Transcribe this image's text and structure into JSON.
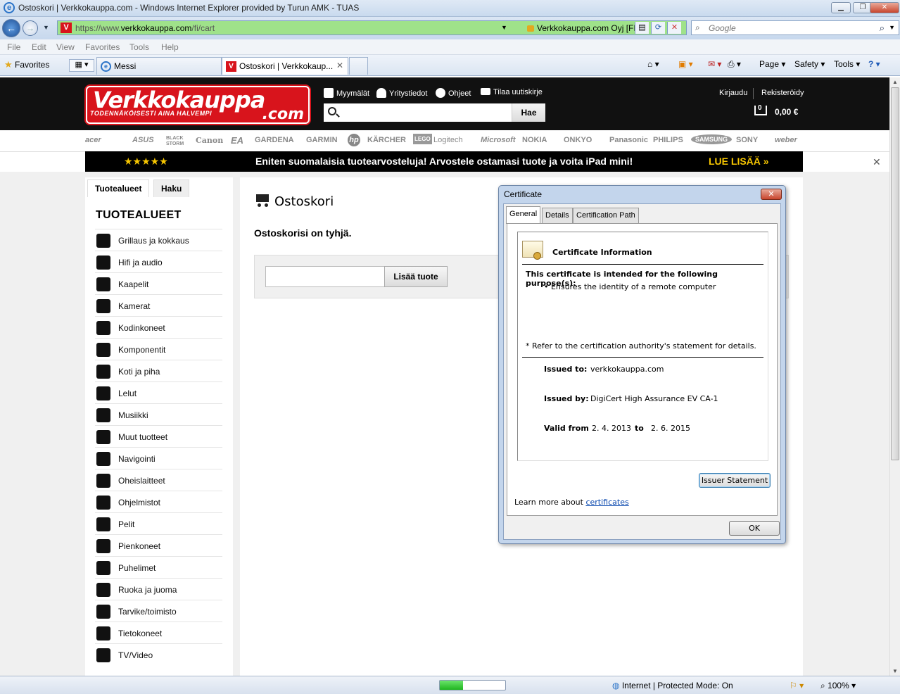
{
  "window": {
    "title": "Ostoskori | Verkkokauppa.com - Windows Internet Explorer provided by Turun AMK - TUAS"
  },
  "address": {
    "url_prefix": "https://www.",
    "url_host": "verkkokauppa.com",
    "url_path": "/fi/cart",
    "cert_label": "Verkkokauppa.com Oyj [FI]"
  },
  "search": {
    "placeholder": "Google"
  },
  "menu": [
    "File",
    "Edit",
    "View",
    "Favorites",
    "Tools",
    "Help"
  ],
  "tabs": {
    "favorites": "Favorites",
    "messi": "Messi",
    "active": "Ostoskori | Verkkokaup..."
  },
  "commands": {
    "page": "Page",
    "safety": "Safety",
    "tools": "Tools"
  },
  "site": {
    "logo_top": "Verkkokauppa",
    "logo_com": ".com",
    "logo_tagline": "TODENNÄKÖISESTI AINA HALVEMPI",
    "links": [
      "Myymälät",
      "Yritystiedot",
      "Ohjeet",
      "Tilaa uutiskirje"
    ],
    "search_button": "Hae",
    "login": "Kirjaudu",
    "register": "Rekisteröidy",
    "cart_count": "0",
    "cart_total": "0,00 €",
    "brands": [
      "acer",
      "ASUS",
      "BLACK STORM",
      "Canon",
      "EA",
      "GARDENA",
      "GARMIN",
      "hp",
      "KÄRCHER",
      "LEGO",
      "Logitech",
      "Microsoft",
      "NOKIA",
      "ONKYO",
      "Panasonic",
      "PHILIPS",
      "SAMSUNG",
      "SONY",
      "weber"
    ],
    "banner": {
      "stars": "★★★★★",
      "message": "Eniten suomalaisia tuotearvosteluja! Arvostele ostamasi tuote ja voita iPad mini!",
      "more": "LUE LISÄÄ »"
    }
  },
  "sidebar": {
    "tab_categories": "Tuotealueet",
    "tab_search": "Haku",
    "heading": "TUOTEALUEET",
    "categories": [
      "Grillaus ja kokkaus",
      "Hifi ja audio",
      "Kaapelit",
      "Kamerat",
      "Kodinkoneet",
      "Komponentit",
      "Koti ja piha",
      "Lelut",
      "Musiikki",
      "Muut tuotteet",
      "Navigointi",
      "Oheislaitteet",
      "Ohjelmistot",
      "Pelit",
      "Pienkoneet",
      "Puhelimet",
      "Ruoka ja juoma",
      "Tarvike/toimisto",
      "Tietokoneet",
      "TV/Video"
    ]
  },
  "main": {
    "title": "Ostoskori",
    "empty_message": "Ostoskorisi on tyhjä.",
    "add_button": "Lisää tuote"
  },
  "dialog": {
    "title": "Certificate",
    "tabs": [
      "General",
      "Details",
      "Certification Path"
    ],
    "info_heading": "Certificate Information",
    "purpose_heading": "This certificate is intended for the following purpose(s):",
    "purpose_item": "• Ensures the identity of a remote computer",
    "note": "* Refer to the certification authority's statement for details.",
    "issued_to_label": "Issued to:",
    "issued_to": "verkkokauppa.com",
    "issued_by_label": "Issued by:",
    "issued_by": "DigiCert High Assurance EV CA-1",
    "valid_from_label": "Valid from",
    "valid_from": "2. 4. 2013",
    "valid_to_label": "to",
    "valid_to": "2. 6. 2015",
    "issuer_button": "Issuer Statement",
    "learn_more": "Learn more about",
    "learn_link": "certificates",
    "ok_button": "OK"
  },
  "status": {
    "zone": "Internet | Protected Mode: On",
    "zoom": "100%",
    "progress": 0.36
  }
}
